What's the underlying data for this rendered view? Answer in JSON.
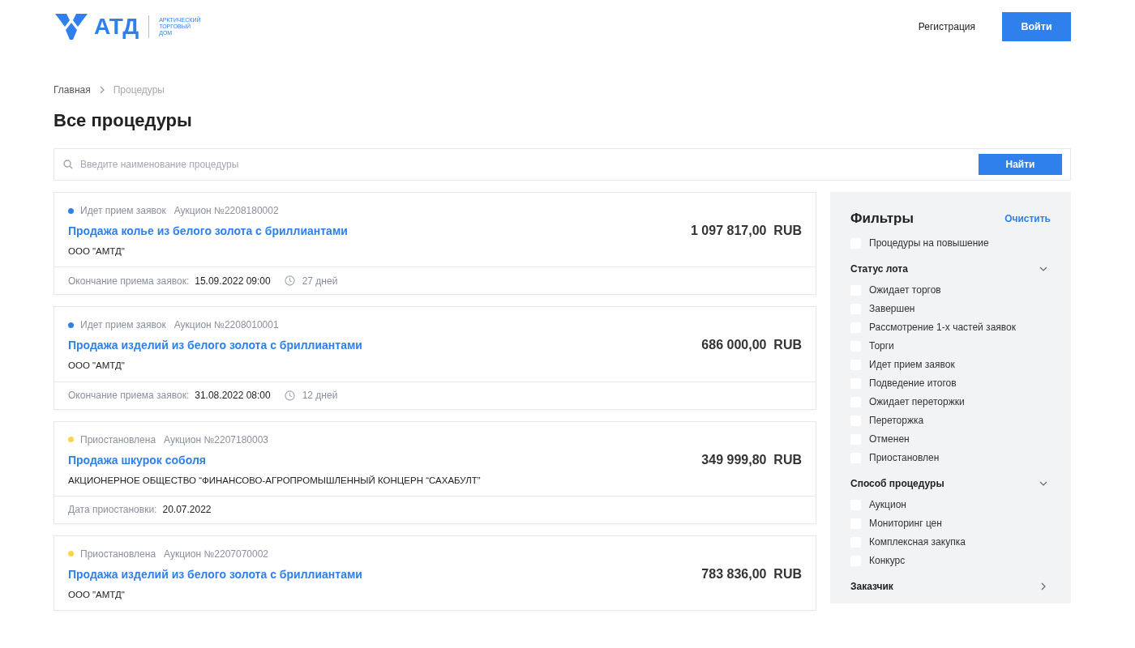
{
  "header": {
    "logo": {
      "mark": "АТД",
      "lines": [
        "АРКТИЧЕСКИЙ",
        "ТОРГОВЫЙ",
        "ДОМ"
      ]
    },
    "register": "Регистрация",
    "login": "Войти"
  },
  "breadcrumbs": [
    {
      "label": "Главная",
      "current": false
    },
    {
      "label": "Процедуры",
      "current": true
    }
  ],
  "title": "Все процедуры",
  "search": {
    "placeholder": "Введите наименование процедуры",
    "button": "Найти"
  },
  "procedures": [
    {
      "status": "Идет прием заявок",
      "color": "#2f80ed",
      "number": "Аукцион №2208180002",
      "title": "Продажа колье из белого золота с бриллиантами",
      "org": "ООО \"АМТД\"",
      "price": "1 097 817,00  RUB",
      "footer_label": "Окончание приема заявок:",
      "footer_value": "15.09.2022 09:00",
      "days": "27 дней"
    },
    {
      "status": "Идет прием заявок",
      "color": "#2f80ed",
      "number": "Аукцион №2208010001",
      "title": "Продажа изделий из белого золота с бриллиантами",
      "org": "ООО \"АМТД\"",
      "price": "686 000,00  RUB",
      "footer_label": "Окончание приема заявок:",
      "footer_value": "31.08.2022 08:00",
      "days": "12 дней"
    },
    {
      "status": "Приостановлена",
      "color": "#fcd34d",
      "number": "Аукцион №2207180003",
      "title": "Продажа шкурок соболя",
      "org": "АКЦИОНЕРНОЕ ОБЩЕСТВО “ФИНАНСОВО-АГРОПРОМЫШЛЕННЫЙ КОНЦЕРН “САХАБУЛТ”",
      "price": "349 999,80  RUB",
      "footer_label": "Дата приостановки:",
      "footer_value": "20.07.2022"
    },
    {
      "status": "Приостановлена",
      "color": "#fcd34d",
      "number": "Аукцион №2207070002",
      "title": "Продажа изделий из белого золота с бриллиантами",
      "org": "ООО \"АМТД\"",
      "price": "783 836,00  RUB"
    }
  ],
  "filters": {
    "title": "Фильтры",
    "clear": "Очистить",
    "items": [
      {
        "kind": "checkbox",
        "label": "Процедуры на повышение",
        "checked": false
      },
      {
        "kind": "section",
        "title": "Статус лота",
        "expanded": true,
        "options": [
          {
            "label": "Ожидает торгов",
            "checked": false
          },
          {
            "label": "Завершен",
            "checked": false
          },
          {
            "label": "Рассмотрение 1-х частей заявок",
            "checked": false
          },
          {
            "label": "Торги",
            "checked": false
          },
          {
            "label": "Идет прием заявок",
            "checked": false
          },
          {
            "label": "Подведение итогов",
            "checked": false
          },
          {
            "label": "Ожидает переторжки",
            "checked": false
          },
          {
            "label": "Переторжка",
            "checked": false
          },
          {
            "label": "Отменен",
            "checked": false
          },
          {
            "label": "Приостановлен",
            "checked": false
          }
        ]
      },
      {
        "kind": "section",
        "title": "Способ процедуры",
        "expanded": true,
        "options": [
          {
            "label": "Аукцион",
            "checked": false
          },
          {
            "label": "Мониторинг цен",
            "checked": false
          },
          {
            "label": "Комплексная закупка",
            "checked": false
          },
          {
            "label": "Конкурс",
            "checked": false
          }
        ]
      },
      {
        "kind": "section",
        "title": "Заказчик",
        "expanded": false
      }
    ]
  }
}
